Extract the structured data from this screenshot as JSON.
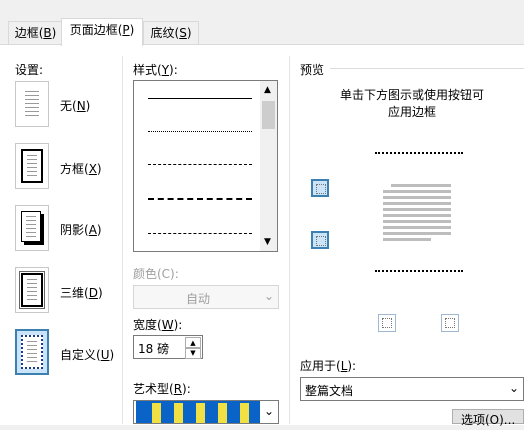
{
  "tabs": [
    {
      "label": "边框(",
      "key": "B",
      "suffix": ")"
    },
    {
      "label": "页面边框(",
      "key": "P",
      "suffix": ")"
    },
    {
      "label": "底纹(",
      "key": "S",
      "suffix": ")"
    }
  ],
  "settings": {
    "title": "设置:",
    "items": [
      {
        "label": "无(",
        "key": "N",
        "suffix": ")"
      },
      {
        "label": "方框(",
        "key": "X",
        "suffix": ")"
      },
      {
        "label": "阴影(",
        "key": "A",
        "suffix": ")"
      },
      {
        "label": "三维(",
        "key": "D",
        "suffix": ")"
      },
      {
        "label": "自定义(",
        "key": "U",
        "suffix": ")"
      }
    ],
    "selected": "自定义"
  },
  "style": {
    "title": "样式(",
    "key": "Y",
    "suffix": "):"
  },
  "color": {
    "label": "颜色(C):",
    "value": "自动"
  },
  "width": {
    "label": "宽度(",
    "key": "W",
    "suffix": "):",
    "value": "18 磅"
  },
  "art": {
    "label": "艺术型(",
    "key": "R",
    "suffix": "):"
  },
  "preview": {
    "title": "预览",
    "hint1": "单击下方图示或使用按钮可",
    "hint2": "应用边框"
  },
  "apply": {
    "label": "应用于(",
    "key": "L",
    "suffix": "):",
    "value": "整篇文档"
  },
  "options": {
    "label": "选项(O)..."
  }
}
